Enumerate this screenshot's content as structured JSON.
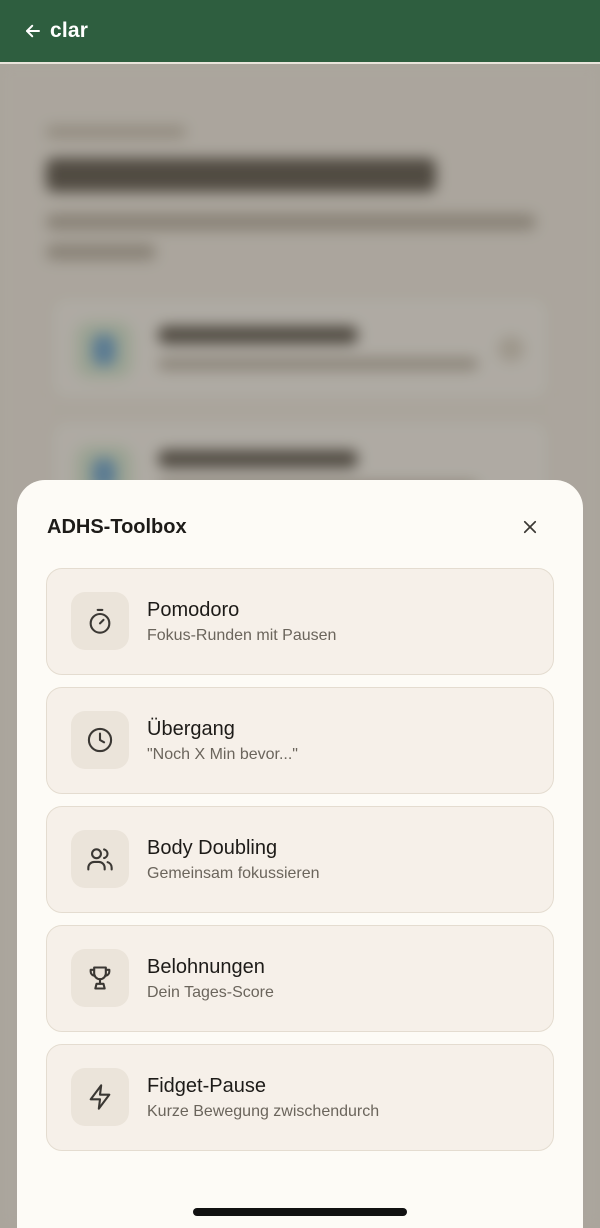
{
  "app_bar": {
    "back_label": "clar",
    "background_color": "#2e5e3f"
  },
  "sheet": {
    "title": "ADHS-Toolbox",
    "close_icon": "close-icon",
    "items": [
      {
        "id": "pomodoro",
        "icon": "timer-icon",
        "title": "Pomodoro",
        "subtitle": "Fokus-Runden mit Pausen"
      },
      {
        "id": "uebergang",
        "icon": "clock-icon",
        "title": "Übergang",
        "subtitle": "\"Noch X Min bevor...\""
      },
      {
        "id": "body-doubling",
        "icon": "users-icon",
        "title": "Body Doubling",
        "subtitle": "Gemeinsam fokussieren"
      },
      {
        "id": "belohnungen",
        "icon": "trophy-icon",
        "title": "Belohnungen",
        "subtitle": "Dein Tages-Score"
      },
      {
        "id": "fidget-pause",
        "icon": "zap-icon",
        "title": "Fidget-Pause",
        "subtitle": "Kurze Bewegung zwischendurch"
      }
    ]
  },
  "colors": {
    "sheet_background": "#fdfbf6",
    "item_background": "#f6f0e9",
    "icon_tile": "#ebe4da",
    "icon_stroke": "#3b3834"
  }
}
